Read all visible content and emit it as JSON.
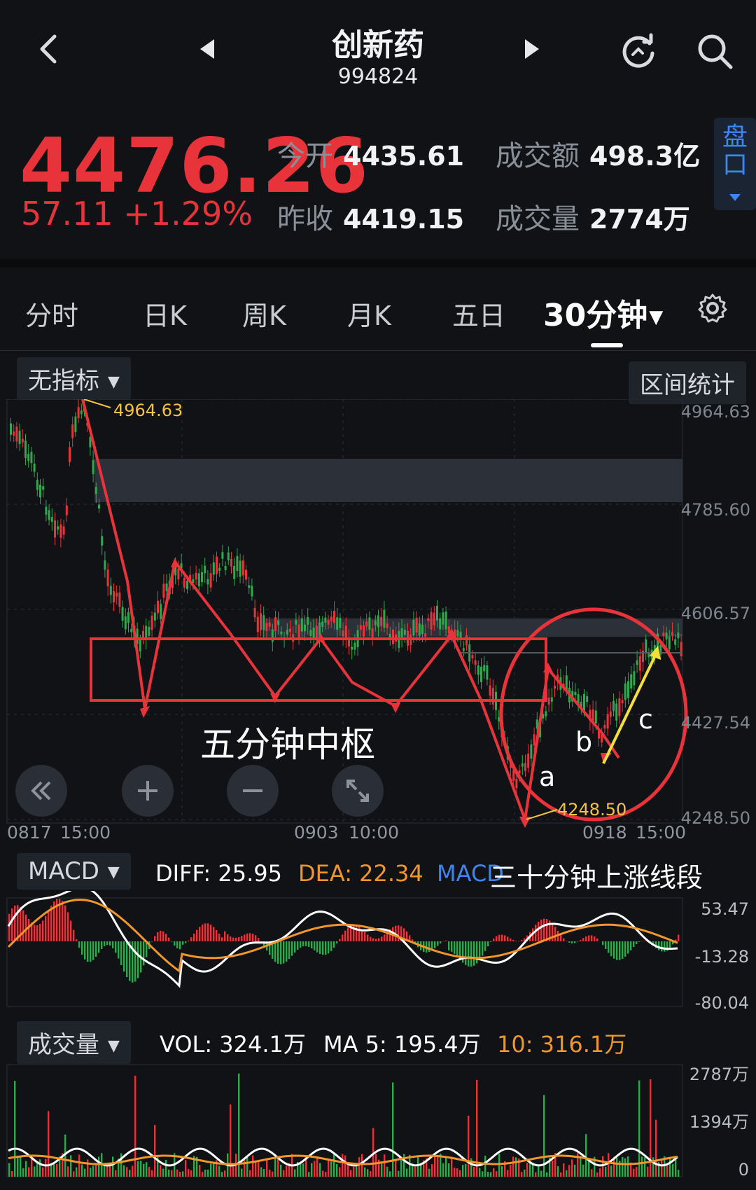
{
  "header": {
    "back_icon": "chevron-left-icon",
    "prev_icon": "triangle-left-icon",
    "next_icon": "triangle-right-icon",
    "refresh_icon": "refresh-icon",
    "search_icon": "search-icon",
    "title": "创新药",
    "code": "994824"
  },
  "quote": {
    "price": "4476.26",
    "change": "57.11 +1.29%",
    "open_label": "今开",
    "open_value": "4435.61",
    "prev_close_label": "昨收",
    "prev_close_value": "4419.15",
    "turnover_label": "成交额",
    "turnover_value": "498.3亿",
    "volume_label": "成交量",
    "volume_value": "2774万",
    "pankou_label": "盘口",
    "up_color": "#e8333a",
    "down_color": "#2fa84f"
  },
  "tabs": [
    {
      "label": "分时"
    },
    {
      "label": "日K"
    },
    {
      "label": "周K"
    },
    {
      "label": "月K"
    },
    {
      "label": "五日"
    },
    {
      "label": "30分钟",
      "active": true
    }
  ],
  "toolbar": {
    "indicator_dropdown": "无指标",
    "range_stats_button": "区间统计",
    "settings_icon": "gear-icon"
  },
  "main_chart": {
    "y_ticks": [
      "4964.63",
      "4785.60",
      "4606.57",
      "4427.54",
      "4248.50"
    ],
    "x_ticks": [
      "0817",
      "15:00",
      "0903",
      "10:00",
      "0918",
      "15:00"
    ],
    "high_label": "4964.63",
    "low_label": "4248.50",
    "annotation_zone": "五分钟中枢",
    "annotation_segment": "三十分钟上涨线段",
    "wave_labels": [
      "a",
      "b",
      "c"
    ],
    "controls": [
      "scroll-left-icon",
      "zoom-in-icon",
      "zoom-out-icon",
      "fullscreen-icon"
    ]
  },
  "macd": {
    "dropdown": "MACD",
    "diff": "DIFF: 25.95",
    "dea": "DEA: 22.34",
    "macd": "MACD",
    "y_ticks": [
      "53.47",
      "-13.28",
      "-80.04"
    ],
    "diff_color": "#ffffff",
    "dea_color": "#f0962a",
    "macd_color": "#3d86f0"
  },
  "volume": {
    "dropdown": "成交量",
    "vol": "VOL: 324.1万",
    "ma5": "MA 5: 195.4万",
    "ma10": "10: 316.1万",
    "y_ticks": [
      "2787万",
      "1394万",
      "0"
    ]
  }
}
